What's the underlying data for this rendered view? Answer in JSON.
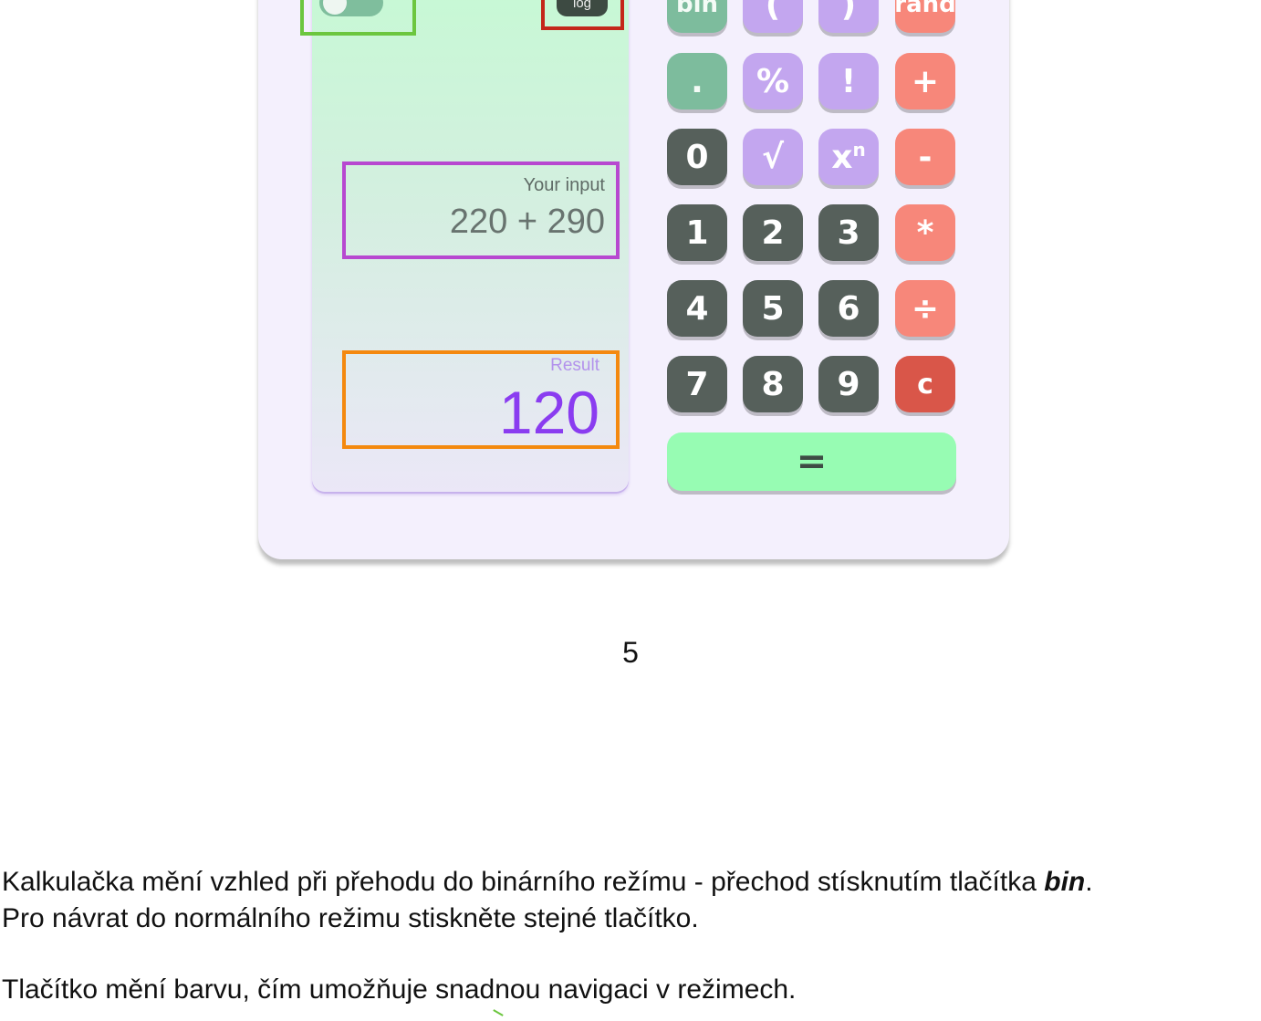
{
  "calculator": {
    "mode_toggle": {
      "state": "off"
    },
    "log_button": {
      "label": "log"
    },
    "input": {
      "label": "Your input",
      "value": "220 + 290"
    },
    "result": {
      "label": "Result",
      "value": "120"
    },
    "keys": {
      "row0": [
        "bin",
        "(",
        ")",
        "rand"
      ],
      "row1": [
        ".",
        "%",
        "!",
        "+"
      ],
      "row2": [
        "0",
        "√",
        "x",
        "-"
      ],
      "row2_sup": "n",
      "row3": [
        "1",
        "2",
        "3",
        "*"
      ],
      "row4": [
        "4",
        "5",
        "6",
        "÷"
      ],
      "row5": [
        "7",
        "8",
        "9",
        "c"
      ],
      "equals": "="
    }
  },
  "page_number": "5",
  "description": {
    "line1_before": "Kalkulačka mění vzhled při přehodu do binárního režímu - přechod stísknutím tlačítka ",
    "line1_bold": "bin",
    "line1_after": ".",
    "line2": "Pro návrat do normálního režimu stiskněte stejné tlačítko.",
    "line3": "Tlačítko mění barvu, čím umožňuje snadnou navigaci v režimech."
  },
  "colors": {
    "highlight_toggle": "#6cc63f",
    "highlight_log": "#c4261a",
    "highlight_input": "#b748d0",
    "highlight_result": "#f4890f",
    "result_text": "#8a3cf0"
  }
}
